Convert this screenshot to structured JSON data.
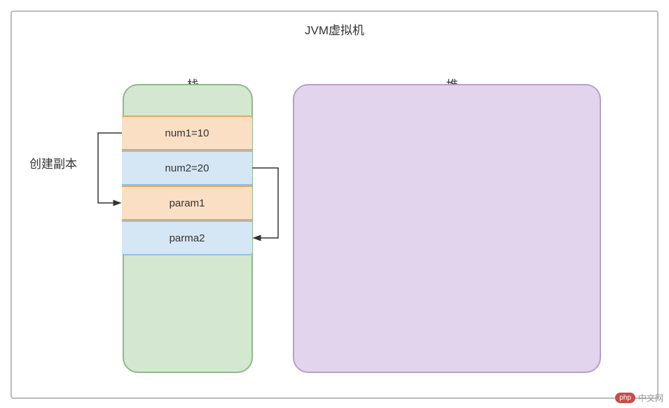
{
  "jvm": {
    "title": "JVM虚拟机",
    "stack_label": "栈",
    "heap_label": "堆",
    "copy_label": "创建副本",
    "frames": [
      {
        "text": "num1=10"
      },
      {
        "text": "num2=20"
      },
      {
        "text": "param1"
      },
      {
        "text": "parma2"
      }
    ]
  },
  "watermark": {
    "badge": "php",
    "text": "中文网"
  },
  "chart_data": {
    "type": "diagram",
    "title": "JVM虚拟机",
    "regions": [
      {
        "name": "栈",
        "items": [
          "num1=10",
          "num2=20",
          "param1",
          "parma2"
        ]
      },
      {
        "name": "堆",
        "items": []
      }
    ],
    "arrows": [
      {
        "from": "num1=10",
        "to": "param1",
        "label": "创建副本"
      },
      {
        "from": "num2=20",
        "to": "parma2",
        "label": "创建副本"
      }
    ]
  }
}
